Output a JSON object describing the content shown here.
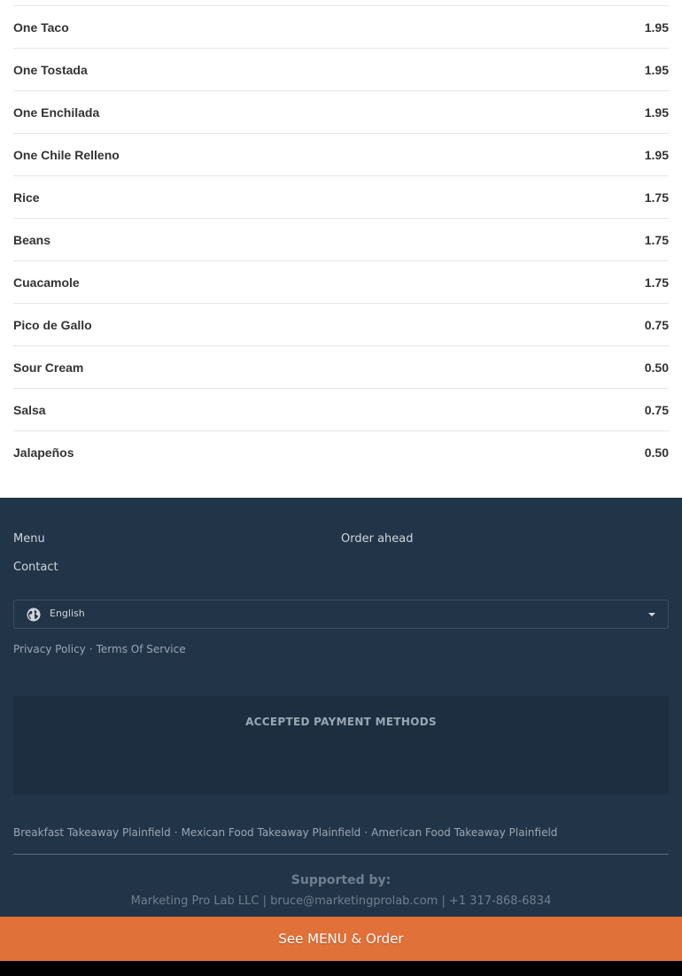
{
  "menu_items": [
    {
      "name": "One Taco",
      "price": "1.95"
    },
    {
      "name": "One Tostada",
      "price": "1.95"
    },
    {
      "name": "One Enchilada",
      "price": "1.95"
    },
    {
      "name": "One Chile Relleno",
      "price": "1.95"
    },
    {
      "name": "Rice",
      "price": "1.75"
    },
    {
      "name": "Beans",
      "price": "1.75"
    },
    {
      "name": "Cuacamole",
      "price": "1.75"
    },
    {
      "name": "Pico de Gallo",
      "price": "0.75"
    },
    {
      "name": "Sour Cream",
      "price": "0.50"
    },
    {
      "name": "Salsa",
      "price": "0.75"
    },
    {
      "name": "Jalapeños",
      "price": "0.50"
    }
  ],
  "footer": {
    "links": {
      "menu": "Menu",
      "order_ahead": "Order ahead",
      "contact": "Contact"
    },
    "language": {
      "selected": "English",
      "icon": "globe-icon"
    },
    "legal": {
      "privacy": "Privacy Policy",
      "terms": "Terms Of Service",
      "separator": "·"
    },
    "payment": {
      "title": "ACCEPTED PAYMENT METHODS"
    },
    "categories": [
      "Breakfast Takeaway Plainfield",
      "Mexican Food Takeaway Plainfield",
      "American Food Takeaway Plainfield"
    ],
    "supported": {
      "title": "Supported by:",
      "line": "Marketing Pro Lab LLC | bruce@marketingprolab.com | +1 317-868-6834"
    }
  },
  "cta": {
    "label": "See MENU & Order"
  },
  "colors": {
    "footer_bg": "#223448",
    "cta_bg": "#e07139"
  }
}
